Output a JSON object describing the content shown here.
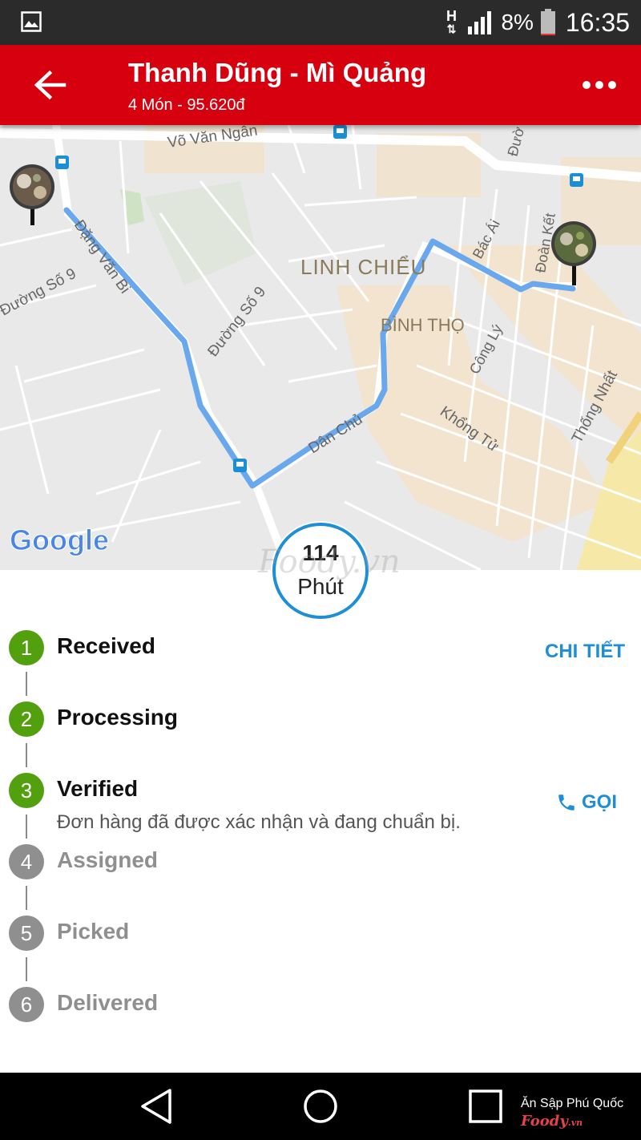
{
  "status_bar": {
    "network": "H",
    "battery_percent": "8%",
    "time": "16:35",
    "battery_level": 0.08
  },
  "header": {
    "title": "Thanh Dũng - Mì Quảng",
    "subtitle": "4 Món - 95.620đ"
  },
  "map": {
    "logo": "Google",
    "labels": {
      "vo_van_ngan": "Võ Văn Ngân",
      "dang_van_bi": "Đặng Văn Bi",
      "duong_so_9a": "Đường Số 9",
      "duong_so_9b": "Đường Số 9",
      "linh_chieu": "LINH CHIỂU",
      "binh_tho": "BÌNH THỌ",
      "bac_ai": "Bác Ái",
      "doan_ket": "Đoàn Kết",
      "cong_ly": "Công Lý",
      "dan_chu": "Dân Chủ",
      "khong_tu": "Khổng Tử",
      "thong_nhat": "Thống Nhất",
      "duong_edge": "Đườ"
    }
  },
  "eta": {
    "value": "114",
    "unit": "Phút"
  },
  "watermark": "Foody.vn",
  "steps": [
    {
      "number": "1",
      "label": "Received",
      "state": "done"
    },
    {
      "number": "2",
      "label": "Processing",
      "state": "done"
    },
    {
      "number": "3",
      "label": "Verified",
      "state": "done",
      "description": "Đơn hàng đã được xác nhận và đang chuẩn bị."
    },
    {
      "number": "4",
      "label": "Assigned",
      "state": "pending"
    },
    {
      "number": "5",
      "label": "Picked",
      "state": "pending"
    },
    {
      "number": "6",
      "label": "Delivered",
      "state": "pending"
    }
  ],
  "actions": {
    "details": "CHI TIẾT",
    "call": "GỌI"
  },
  "nav_watermark": {
    "caption": "Ăn Sập Phú Quốc",
    "brand": "Foody",
    "brand_suffix": ".vn"
  },
  "colors": {
    "app_bar": "#d6000e",
    "step_done": "#52a00e",
    "step_pending": "#8f8f8f",
    "accent": "#1e8fd6",
    "route": "#6aa8ee"
  },
  "icons": {
    "back": "arrow-left-icon",
    "more": "more-dots-icon",
    "call": "phone-icon"
  }
}
